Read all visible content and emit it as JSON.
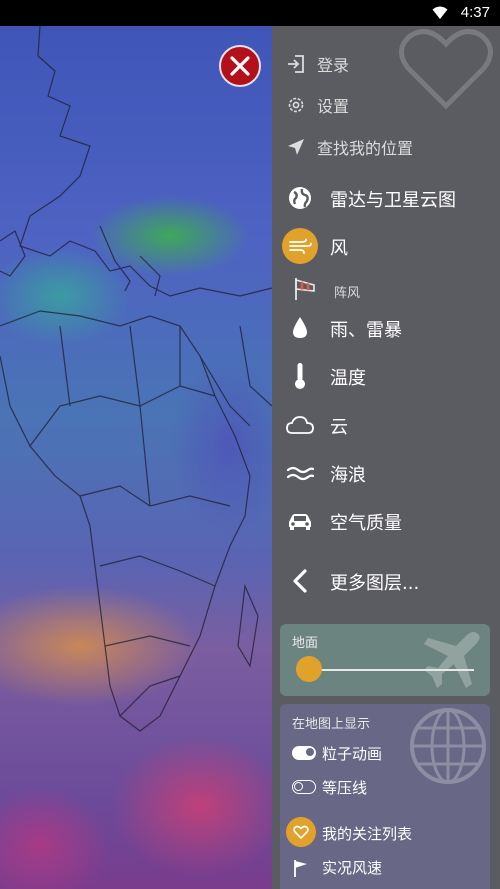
{
  "status_bar": {
    "time": "4:37"
  },
  "menu": {
    "login": "登录",
    "settings": "设置",
    "find_location": "查找我的位置",
    "radar_satellite": "雷达与卫星云图",
    "wind": "风",
    "gust": "阵风",
    "rain_thunder": "雨、雷暴",
    "temperature": "温度",
    "clouds": "云",
    "waves": "海浪",
    "air_quality": "空气质量",
    "more_layers": "更多图层..."
  },
  "ground": {
    "title": "地面",
    "level": 0
  },
  "show_on_map": {
    "title": "在地图上显示",
    "particles": {
      "label": "粒子动画",
      "enabled": true
    },
    "isobars": {
      "label": "等压线",
      "enabled": false
    },
    "favorites": "我的关注列表",
    "observed_wind": "实况风速"
  },
  "colors": {
    "accent": "#e0a22b",
    "close": "#b3101c",
    "panel": "#5b5b62"
  }
}
